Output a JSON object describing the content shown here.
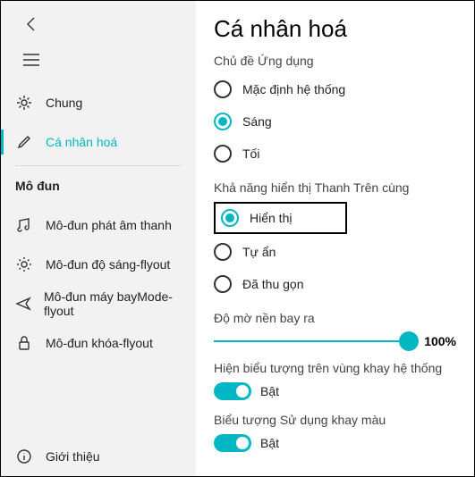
{
  "sidebar": {
    "nav": [
      {
        "label": "Chung"
      },
      {
        "label": "Cá nhân hoá"
      }
    ],
    "section_header": "Mô đun",
    "modules": [
      {
        "label": "Mô-đun phát âm thanh"
      },
      {
        "label": "Mô-đun độ sáng-flyout"
      },
      {
        "label": "Mô-đun máy bayMode-flyout"
      },
      {
        "label": "Mô-đun khóa-flyout"
      }
    ],
    "about": "Giới thiệu"
  },
  "main": {
    "title": "Cá nhân hoá",
    "theme": {
      "header": "Chủ đề Ứng dụng",
      "options": [
        "Mặc định hệ thống",
        "Sáng",
        "Tối"
      ],
      "selected": 1
    },
    "topbar_vis": {
      "header": "Khả năng hiển thị Thanh Trên cùng",
      "options": [
        "Hiển thị",
        "Tự ẩn",
        "Đã thu gọn"
      ],
      "selected": 0
    },
    "opacity": {
      "header": "Độ mờ nền bay ra",
      "value": "100%"
    },
    "tray_icon": {
      "header": "Hiện biểu tượng trên vùng khay hệ thống",
      "label": "Bật"
    },
    "colored_tray": {
      "header": "Biểu tượng Sử dụng khay màu",
      "label": "Bật"
    }
  }
}
